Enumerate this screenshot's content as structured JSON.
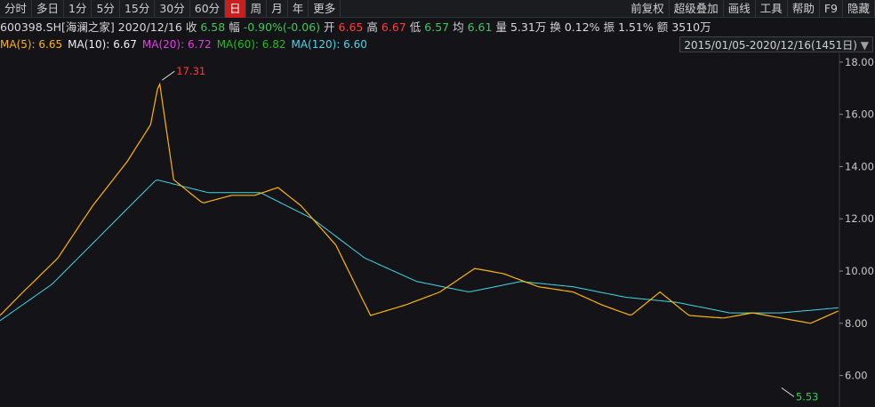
{
  "toolbar": {
    "periods": [
      "分时",
      "多日",
      "1分",
      "5分",
      "15分",
      "30分",
      "60分",
      "日",
      "周",
      "月",
      "年",
      "更多"
    ],
    "active": "日",
    "right": [
      "前复权",
      "超级叠加",
      "画线",
      "工具",
      "帮助",
      "F9",
      "隐藏"
    ]
  },
  "quote": {
    "symbol": "600398.SH[海澜之家]",
    "date": "2020/12/16",
    "close_label": "收",
    "close": "6.58",
    "change_label": "幅",
    "change": "-0.90%(-0.06)",
    "open_label": "开",
    "open": "6.65",
    "high_label": "高",
    "high": "6.67",
    "low_label": "低",
    "low": "6.57",
    "avg_label": "均",
    "avg": "6.61",
    "volume_label": "量",
    "volume": "5.31万",
    "turnover_label": "换",
    "turnover": "0.12%",
    "amplitude_label": "振",
    "amplitude": "1.51%",
    "amount_label": "额",
    "amount": "3510万"
  },
  "ma_legend": [
    {
      "label": "MA(5): 6.65",
      "color": "#ffb400"
    },
    {
      "label": "MA(10): 6.67",
      "color": "#f0f0f0"
    },
    {
      "label": "MA(20): 6.72",
      "color": "#e040e0"
    },
    {
      "label": "MA(60): 6.82",
      "color": "#22bb22"
    },
    {
      "label": "MA(120): 6.60",
      "color": "#40d8e8"
    }
  ],
  "range_label": "2015/01/05-2020/12/16(1451日)",
  "range_arrow": "▼",
  "chart_data": {
    "type": "line",
    "y_ticks": [
      "18.00",
      "16.00",
      "14.00",
      "12.00",
      "10.00",
      "8.00",
      "6.00"
    ],
    "ylim": [
      5.0,
      18.2
    ],
    "x_count": 1451,
    "max_marker": {
      "label": "17.31",
      "value": 17.31,
      "index": 280
    },
    "min_marker": {
      "label": "5.53",
      "value": 5.53,
      "index": 1350
    },
    "ma120_anchors": [
      [
        0,
        8.1
      ],
      [
        90,
        9.5
      ],
      [
        180,
        11.5
      ],
      [
        270,
        13.5
      ],
      [
        360,
        13.0
      ],
      [
        450,
        13.0
      ],
      [
        540,
        12.0
      ],
      [
        630,
        10.5
      ],
      [
        720,
        9.6
      ],
      [
        810,
        9.2
      ],
      [
        900,
        9.6
      ],
      [
        990,
        9.4
      ],
      [
        1080,
        9.0
      ],
      [
        1170,
        8.8
      ],
      [
        1260,
        8.4
      ],
      [
        1350,
        8.4
      ],
      [
        1451,
        8.6
      ]
    ],
    "price_anchors": [
      [
        0,
        8.3
      ],
      [
        40,
        9.2
      ],
      [
        100,
        10.5
      ],
      [
        160,
        12.5
      ],
      [
        220,
        14.2
      ],
      [
        260,
        15.6
      ],
      [
        275,
        17.31
      ],
      [
        300,
        13.5
      ],
      [
        350,
        12.6
      ],
      [
        400,
        12.9
      ],
      [
        440,
        12.9
      ],
      [
        480,
        13.2
      ],
      [
        520,
        12.5
      ],
      [
        580,
        11.0
      ],
      [
        640,
        8.3
      ],
      [
        700,
        8.7
      ],
      [
        760,
        9.2
      ],
      [
        820,
        10.1
      ],
      [
        870,
        9.9
      ],
      [
        930,
        9.4
      ],
      [
        990,
        9.2
      ],
      [
        1040,
        8.7
      ],
      [
        1090,
        8.3
      ],
      [
        1140,
        9.2
      ],
      [
        1190,
        8.3
      ],
      [
        1250,
        8.2
      ],
      [
        1300,
        8.4
      ],
      [
        1350,
        8.2
      ],
      [
        1400,
        8.0
      ],
      [
        1451,
        8.5
      ]
    ]
  }
}
